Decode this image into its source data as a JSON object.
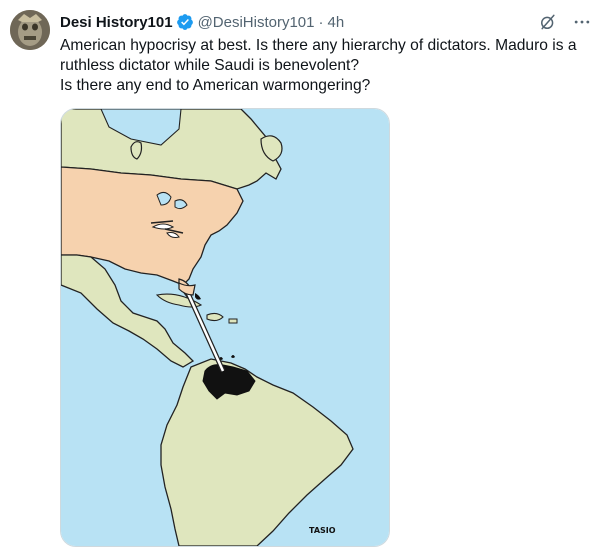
{
  "tweet": {
    "display_name": "Desi History101",
    "handle": "@DesiHistory101",
    "separator": "·",
    "time": "4h",
    "text_lines": [
      "American hypocrisy at best. Is there any hierarchy of dictators. Maduro is a",
      "ruthless dictator while Saudi is benevolent?",
      "Is there any end to American warmongering?"
    ]
  },
  "media": {
    "signature": "TASIO",
    "colors": {
      "ocean": "#b8e2f4",
      "usa": "#f6d2ae",
      "land": "#dfe6be",
      "venezuela_oil": "#111111",
      "outline": "#222222"
    }
  },
  "icons": {
    "verified": "verified-badge-icon",
    "grok": "grok-icon",
    "more": "more-options-icon"
  },
  "colors": {
    "text": "#0f1419",
    "secondary_text": "#536471",
    "verified": "#1d9bf0",
    "border": "#cfd9de"
  }
}
